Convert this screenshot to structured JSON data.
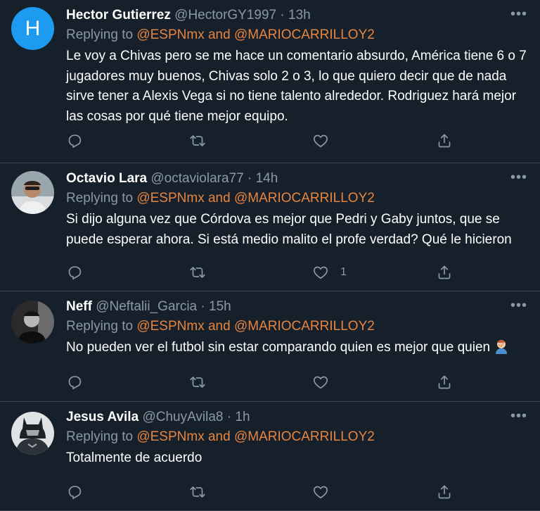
{
  "tweets": [
    {
      "name": "Hector Gutierrez",
      "handle": "@HectorGY1997",
      "separator": "·",
      "time": "13h",
      "avatar_letter": "H",
      "replying_prefix": "Replying to",
      "mention1": "@ESPNmx",
      "and_text": "and",
      "mention2": "@MARIOCARRILLOY2",
      "body": "Le voy a Chivas pero se me hace un comentario absurdo, América tiene 6 o 7 jugadores muy buenos, Chivas solo 2 o 3, lo que quiero decir que de nada sirve tener a Alexis Vega si no tiene talento alrededor. Rodriguez hará mejor las cosas por qué tiene mejor equipo.",
      "like_count": ""
    },
    {
      "name": "Octavio Lara",
      "handle": "@octaviolara77",
      "separator": "·",
      "time": "14h",
      "replying_prefix": "Replying to",
      "mention1": "@ESPNmx",
      "and_text": "and",
      "mention2": "@MARIOCARRILLOY2",
      "body": "Si dijo alguna vez que Córdova es mejor que Pedri y Gaby juntos, que se puede esperar ahora. Si está medio malito el profe verdad? Qué le hicieron",
      "like_count": "1"
    },
    {
      "name": "Neff",
      "handle": "@Neftalii_Garcia",
      "separator": "·",
      "time": "15h",
      "replying_prefix": "Replying to",
      "mention1": "@ESPNmx",
      "and_text": "and",
      "mention2": "@MARIOCARRILLOY2",
      "body": "No pueden ver el futbol sin estar comparando quien es mejor que quien",
      "like_count": ""
    },
    {
      "name": "Jesus Avila",
      "handle": "@ChuyAvila8",
      "separator": "·",
      "time": "1h",
      "replying_prefix": "Replying to",
      "mention1": "@ESPNmx",
      "and_text": "and",
      "mention2": "@MARIOCARRILLOY2",
      "body": "Totalmente de acuerdo",
      "like_count": ""
    }
  ],
  "icons": {
    "more": "more-icon",
    "reply": "reply-icon",
    "retweet": "retweet-icon",
    "like": "like-icon",
    "share": "share-icon",
    "facepalm": "person-facepalming-emoji"
  },
  "colors": {
    "background": "#15202b",
    "divider": "#38444d",
    "text": "#ffffff",
    "secondary": "#8b98a5",
    "mention": "#e8843c",
    "avatar_h": "#1d9bf0"
  }
}
